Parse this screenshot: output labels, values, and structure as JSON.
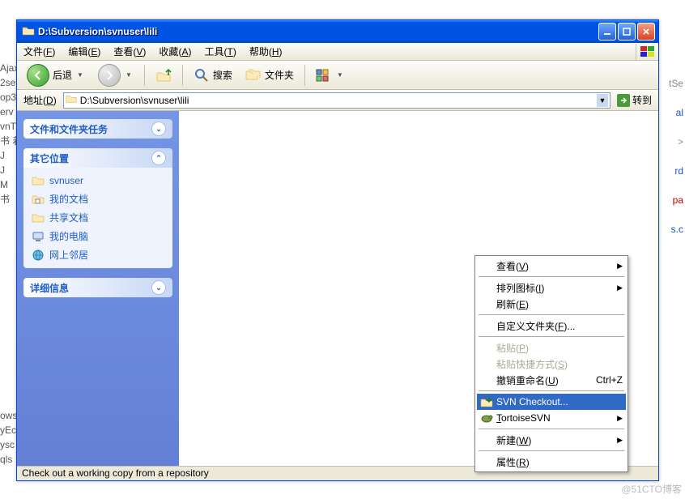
{
  "titlebar": {
    "title": "D:\\Subversion\\svnuser\\lili"
  },
  "menubar": {
    "file": "文件",
    "file_key": "F",
    "edit": "编辑",
    "edit_key": "E",
    "view": "查看",
    "view_key": "V",
    "favorites": "收藏",
    "favorites_key": "A",
    "tools": "工具",
    "tools_key": "T",
    "help": "帮助",
    "help_key": "H"
  },
  "toolbar": {
    "back": "后退",
    "search": "搜索",
    "folders": "文件夹"
  },
  "addressbar": {
    "label": "地址",
    "label_key": "D",
    "path": "D:\\Subversion\\svnuser\\lili",
    "go": "转到"
  },
  "side_panel": {
    "tasks": {
      "title": "文件和文件夹任务"
    },
    "other_places": {
      "title": "其它位置",
      "items": [
        "svnuser",
        "我的文档",
        "共享文档",
        "我的电脑",
        "网上邻居"
      ]
    },
    "details": {
      "title": "详细信息"
    }
  },
  "context_menu": {
    "view": "查看",
    "view_key": "V",
    "arrange": "排列图标",
    "arrange_key": "I",
    "refresh": "刷新",
    "refresh_key": "E",
    "customize": "自定义文件夹",
    "customize_key": "F",
    "paste": "粘贴",
    "paste_key": "P",
    "paste_shortcut": "粘贴快捷方式",
    "paste_shortcut_key": "S",
    "undo_rename": "撤销重命名",
    "undo_rename_key": "U",
    "undo_rename_sc": "Ctrl+Z",
    "svn_checkout": "SVN Checkout...",
    "tortoisesvn": "TortoiseSVN",
    "new": "新建",
    "new_key": "W",
    "properties": "属性",
    "properties_key": "R"
  },
  "statusbar": {
    "text": "Check out a working copy from a repository"
  },
  "bg": {
    "left_items": [
      "Ajax",
      "2se",
      "op3",
      "erv",
      "vnT",
      "书 着",
      " J",
      " J",
      " M",
      " 书"
    ],
    "right_items": [
      "tSe",
      "al",
      ">",
      "rd",
      "pa",
      "s.c"
    ],
    "bottom_left": [
      "ows:",
      "",
      "yEc",
      "ysc",
      "qls"
    ],
    "watermark": "@51CTO博客"
  }
}
